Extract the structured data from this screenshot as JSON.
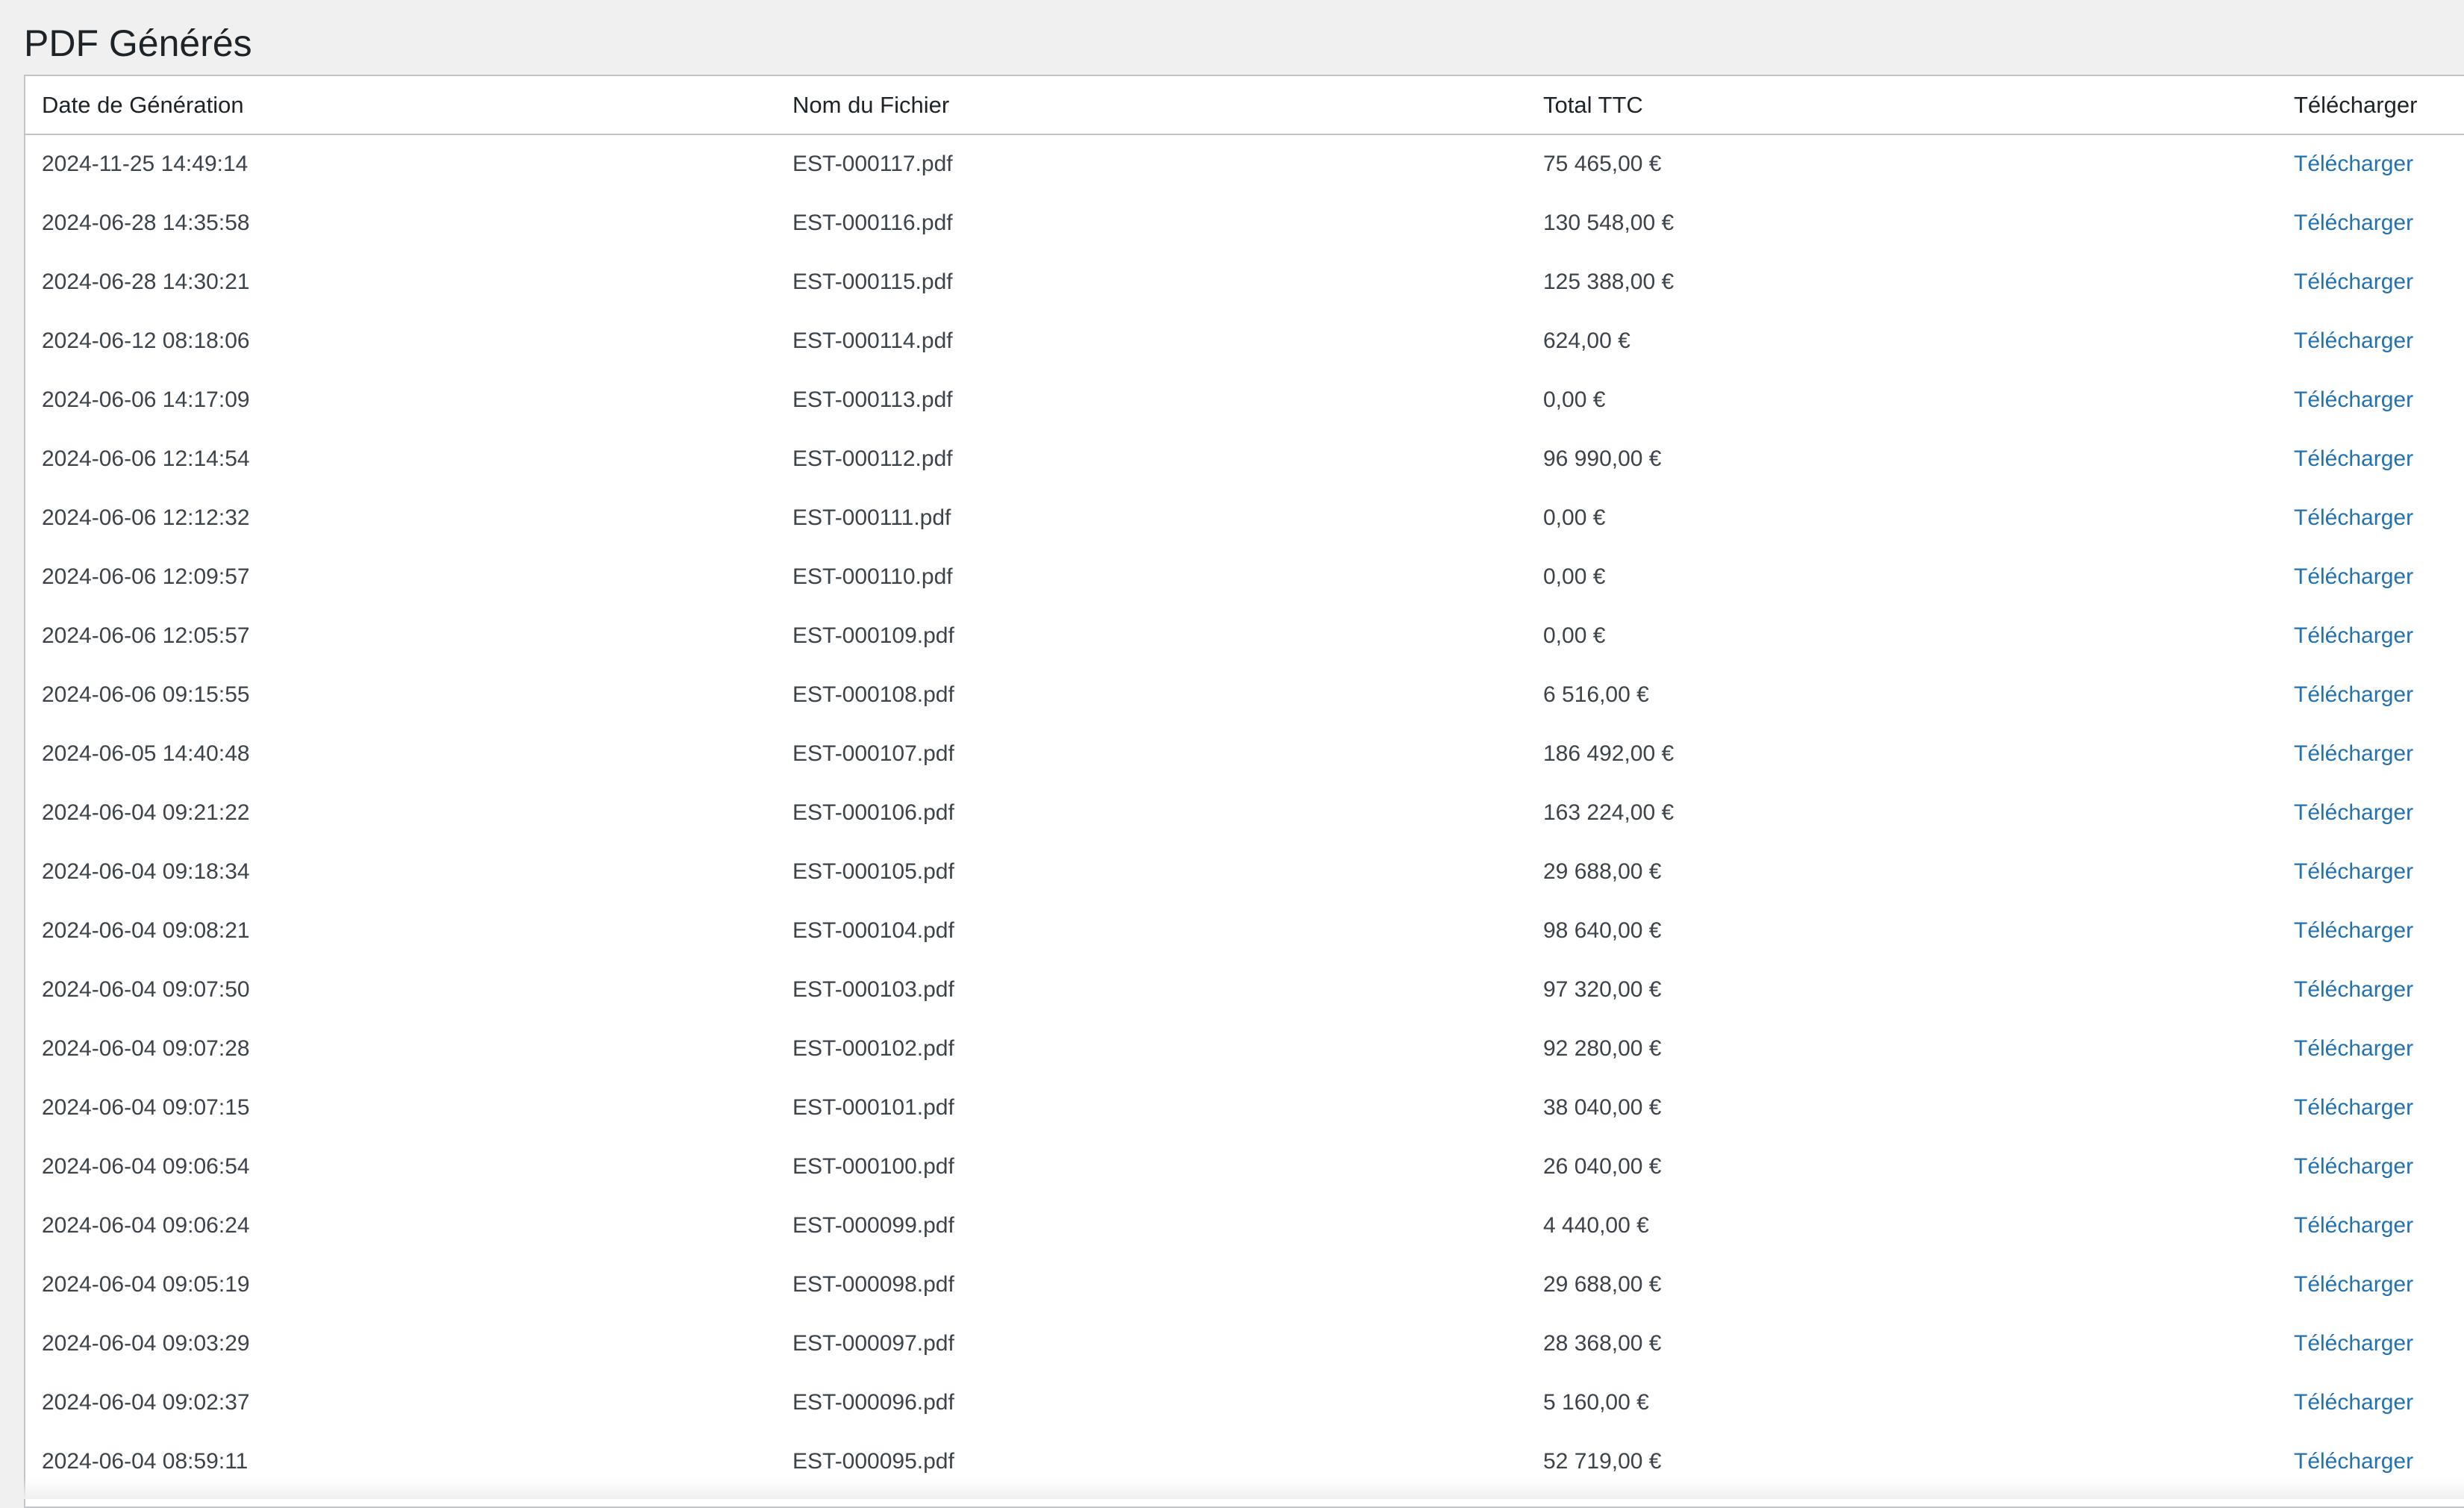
{
  "page": {
    "title": "PDF Générés"
  },
  "table": {
    "headers": [
      "Date de Génération",
      "Nom du Fichier",
      "Total TTC",
      "Télécharger"
    ],
    "rows": [
      {
        "date": "2024-11-25 14:49:14",
        "file": "EST-000117.pdf",
        "total": "75 465,00 €",
        "link": "Télécharger"
      },
      {
        "date": "2024-06-28 14:35:58",
        "file": "EST-000116.pdf",
        "total": "130 548,00 €",
        "link": "Télécharger"
      },
      {
        "date": "2024-06-28 14:30:21",
        "file": "EST-000115.pdf",
        "total": "125 388,00 €",
        "link": "Télécharger"
      },
      {
        "date": "2024-06-12 08:18:06",
        "file": "EST-000114.pdf",
        "total": "624,00 €",
        "link": "Télécharger"
      },
      {
        "date": "2024-06-06 14:17:09",
        "file": "EST-000113.pdf",
        "total": "0,00 €",
        "link": "Télécharger"
      },
      {
        "date": "2024-06-06 12:14:54",
        "file": "EST-000112.pdf",
        "total": "96 990,00 €",
        "link": "Télécharger"
      },
      {
        "date": "2024-06-06 12:12:32",
        "file": "EST-000111.pdf",
        "total": "0,00 €",
        "link": "Télécharger"
      },
      {
        "date": "2024-06-06 12:09:57",
        "file": "EST-000110.pdf",
        "total": "0,00 €",
        "link": "Télécharger"
      },
      {
        "date": "2024-06-06 12:05:57",
        "file": "EST-000109.pdf",
        "total": "0,00 €",
        "link": "Télécharger"
      },
      {
        "date": "2024-06-06 09:15:55",
        "file": "EST-000108.pdf",
        "total": "6 516,00 €",
        "link": "Télécharger"
      },
      {
        "date": "2024-06-05 14:40:48",
        "file": "EST-000107.pdf",
        "total": "186 492,00 €",
        "link": "Télécharger"
      },
      {
        "date": "2024-06-04 09:21:22",
        "file": "EST-000106.pdf",
        "total": "163 224,00 €",
        "link": "Télécharger"
      },
      {
        "date": "2024-06-04 09:18:34",
        "file": "EST-000105.pdf",
        "total": "29 688,00 €",
        "link": "Télécharger"
      },
      {
        "date": "2024-06-04 09:08:21",
        "file": "EST-000104.pdf",
        "total": "98 640,00 €",
        "link": "Télécharger"
      },
      {
        "date": "2024-06-04 09:07:50",
        "file": "EST-000103.pdf",
        "total": "97 320,00 €",
        "link": "Télécharger"
      },
      {
        "date": "2024-06-04 09:07:28",
        "file": "EST-000102.pdf",
        "total": "92 280,00 €",
        "link": "Télécharger"
      },
      {
        "date": "2024-06-04 09:07:15",
        "file": "EST-000101.pdf",
        "total": "38 040,00 €",
        "link": "Télécharger"
      },
      {
        "date": "2024-06-04 09:06:54",
        "file": "EST-000100.pdf",
        "total": "26 040,00 €",
        "link": "Télécharger"
      },
      {
        "date": "2024-06-04 09:06:24",
        "file": "EST-000099.pdf",
        "total": "4 440,00 €",
        "link": "Télécharger"
      },
      {
        "date": "2024-06-04 09:05:19",
        "file": "EST-000098.pdf",
        "total": "29 688,00 €",
        "link": "Télécharger"
      },
      {
        "date": "2024-06-04 09:03:29",
        "file": "EST-000097.pdf",
        "total": "28 368,00 €",
        "link": "Télécharger"
      },
      {
        "date": "2024-06-04 09:02:37",
        "file": "EST-000096.pdf",
        "total": "5 160,00 €",
        "link": "Télécharger"
      },
      {
        "date": "2024-06-04 08:59:11",
        "file": "EST-000095.pdf",
        "total": "52 719,00 €",
        "link": "Télécharger"
      }
    ]
  },
  "colors": {
    "link": "#2271b1",
    "text": "#3c434a",
    "background": "#f0f0f1",
    "border": "#c3c4c7"
  }
}
